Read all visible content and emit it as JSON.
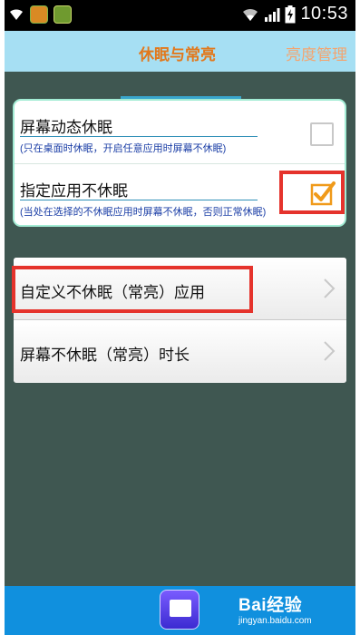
{
  "status_bar": {
    "time": "10:53"
  },
  "tabs": [
    {
      "label": "休眠与常亮",
      "active": true
    },
    {
      "label": "亮度管理",
      "active": false
    }
  ],
  "settings_card": {
    "rows": [
      {
        "title": "屏幕动态休眠",
        "subtitle": "(只在桌面时休眠，开启任意应用时屏幕不休眠)",
        "checked": false
      },
      {
        "title": "指定应用不休眠",
        "subtitle": "(当处在选择的不休眠应用时屏幕不休眠，否则正常休眠)",
        "checked": true
      }
    ]
  },
  "nav_card": {
    "rows": [
      {
        "label": "自定义不休眠（常亮）应用"
      },
      {
        "label": "屏幕不休眠（常亮）时长"
      }
    ]
  },
  "watermark": {
    "brand": "Bai经验",
    "url": "jingyan.baidu.com"
  },
  "colors": {
    "background": "#3f5751",
    "tab_bar": "#a6dff3",
    "active_tab_text": "#e2781b",
    "bottom_bar": "#1090de",
    "highlight_box": "#e5332c",
    "checkbox_checked": "#f09a1a"
  },
  "icons": {
    "status_left": [
      "wifi-icon",
      "app-icon",
      "app-icon"
    ],
    "status_right": [
      "wifi-icon",
      "signal-icon",
      "battery-icon"
    ],
    "nav_row": "chevron-right-icon"
  }
}
